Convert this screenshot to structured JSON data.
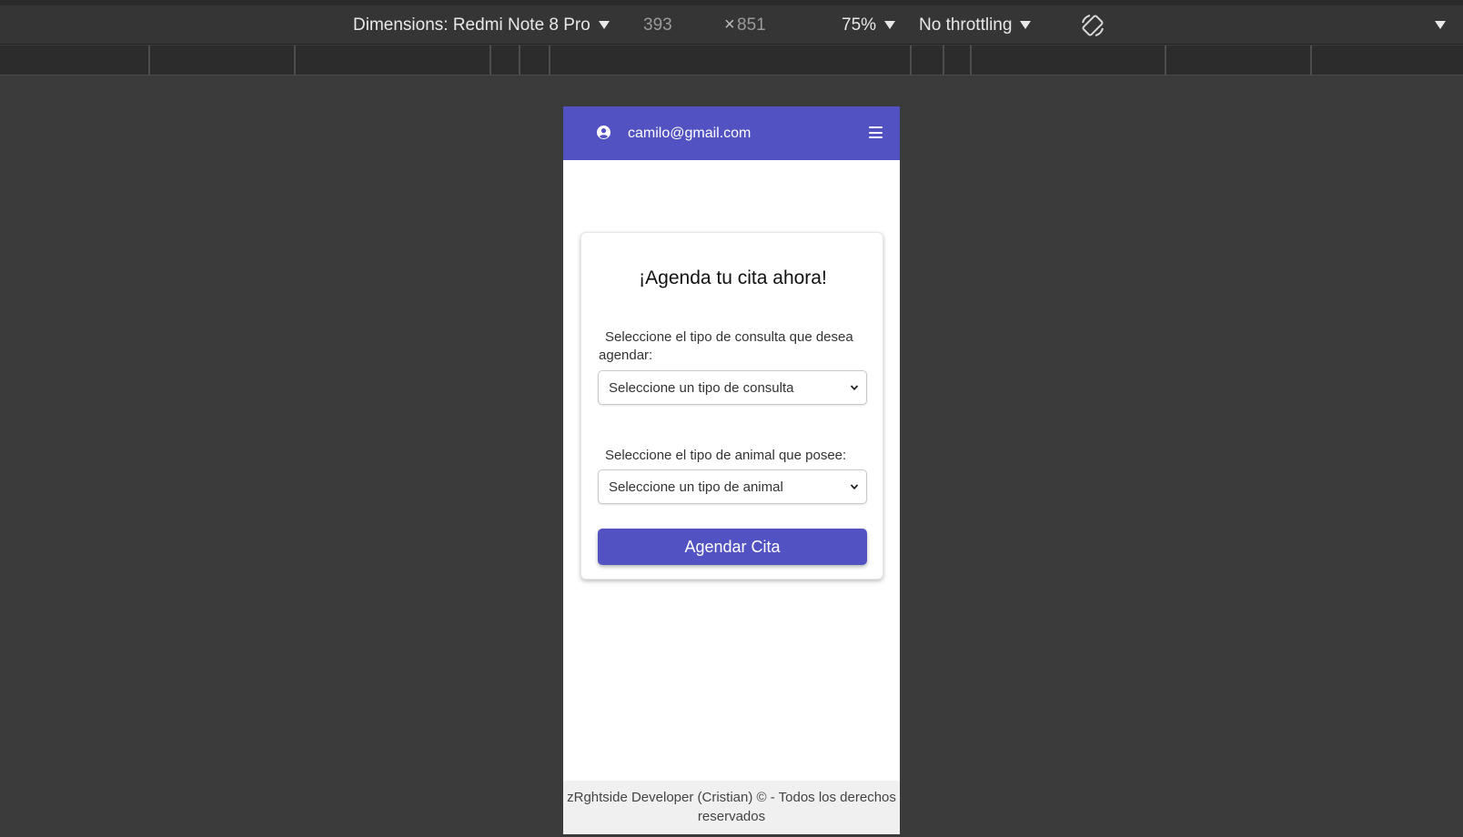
{
  "devtools": {
    "device_label": "Dimensions: Redmi Note 8 Pro",
    "width_value": "393",
    "times_glyph": "×",
    "height_value": "851",
    "zoom_label": "75%",
    "throttling_label": "No throttling",
    "icons": {
      "rotate": "rotate-icon",
      "more": "caret-down-icon"
    }
  },
  "app": {
    "colors": {
      "primary": "#5352c2",
      "footer_bg": "#f0f0f0"
    },
    "navbar": {
      "user_email": "camilo@gmail.com",
      "icons": {
        "user": "user-circle-icon",
        "menu": "hamburger-menu-icon"
      }
    },
    "form": {
      "title": "¡Agenda tu cita ahora!",
      "consulta_label": "Seleccione el tipo de consulta que desea agendar:",
      "consulta_selected": "Seleccione un tipo de consulta",
      "animal_label": "Seleccione el tipo de animal que posee:",
      "animal_selected": "Seleccione un tipo de animal",
      "submit_label": "Agendar Cita"
    },
    "footer": {
      "text": "zRghtside Developer (Cristian) © - Todos los derechos reservados"
    }
  }
}
